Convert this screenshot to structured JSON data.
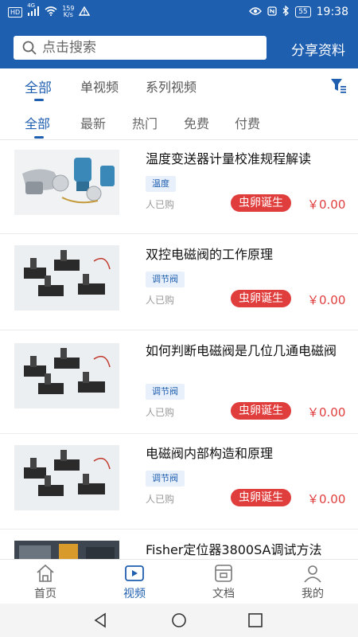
{
  "statusbar": {
    "network": "HD",
    "signal_label": "4G",
    "speed_value": "159",
    "speed_unit": "K/s",
    "battery": "55",
    "time": "19:38"
  },
  "header": {
    "search_placeholder": "点击搜索",
    "share_label": "分享资料"
  },
  "tabs_primary": [
    {
      "label": "全部",
      "active": true
    },
    {
      "label": "单视频",
      "active": false
    },
    {
      "label": "系列视频",
      "active": false
    }
  ],
  "tabs_secondary": [
    {
      "label": "全部",
      "active": true
    },
    {
      "label": "最新",
      "active": false
    },
    {
      "label": "热门",
      "active": false
    },
    {
      "label": "免费",
      "active": false
    },
    {
      "label": "付费",
      "active": false
    }
  ],
  "videos": [
    {
      "title": "温度变送器计量校准规程解读",
      "tag": "温度",
      "bought": "人已购",
      "author": "虫卵诞生",
      "price": "￥0.00"
    },
    {
      "title": "双控电磁阀的工作原理",
      "tag": "调节阀",
      "bought": "人已购",
      "author": "虫卵诞生",
      "price": "￥0.00"
    },
    {
      "title": "如何判断电磁阀是几位几通电磁阀",
      "tag": "调节阀",
      "bought": "人已购",
      "author": "虫卵诞生",
      "price": "￥0.00"
    },
    {
      "title": "电磁阀内部构造和原理",
      "tag": "调节阀",
      "bought": "人已购",
      "author": "虫卵诞生",
      "price": "￥0.00"
    },
    {
      "title": "Fisher定位器3800SA调试方法",
      "tag": "",
      "bought": "",
      "author": "",
      "price": ""
    }
  ],
  "bottom_nav": [
    {
      "label": "首页",
      "icon": "home-icon",
      "active": false
    },
    {
      "label": "视频",
      "icon": "video-icon",
      "active": true
    },
    {
      "label": "文档",
      "icon": "document-icon",
      "active": false
    },
    {
      "label": "我的",
      "icon": "profile-icon",
      "active": false
    }
  ],
  "colors": {
    "brand": "#1f5fb0",
    "accent_red": "#e03d3d",
    "tag_bg": "#e8f0fb"
  }
}
